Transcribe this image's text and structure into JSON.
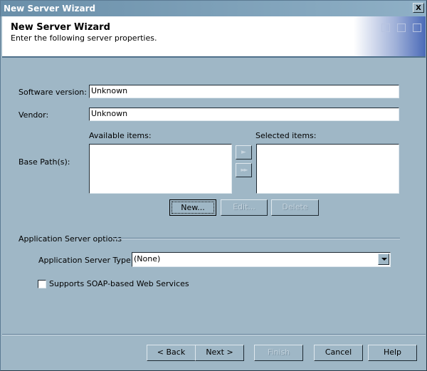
{
  "window": {
    "title": "New Server Wizard",
    "close_label": "X"
  },
  "header": {
    "title": "New Server Wizard",
    "subtitle": "Enter the following server properties."
  },
  "form": {
    "software_version": {
      "label": "Software version:",
      "value": "Unknown"
    },
    "vendor": {
      "label": "Vendor:",
      "value": "Unknown"
    },
    "base_paths": {
      "label": "Base Path(s):",
      "available_label": "Available items:",
      "selected_label": "Selected items:",
      "available_items": [],
      "selected_items": [],
      "move_right_icon": "►",
      "move_all_right_icon": "►►",
      "new_label": "New...",
      "edit_label": "Edit...",
      "delete_label": "Delete"
    }
  },
  "app_server": {
    "group_label": "Application Server options",
    "type_label": "Application Server Type:",
    "type_value": "(None)",
    "soap_label": "Supports SOAP-based Web Services",
    "soap_checked": false
  },
  "footer": {
    "back_label": "< Back",
    "next_label": "Next >",
    "finish_label": "Finish",
    "cancel_label": "Cancel",
    "help_label": "Help"
  }
}
